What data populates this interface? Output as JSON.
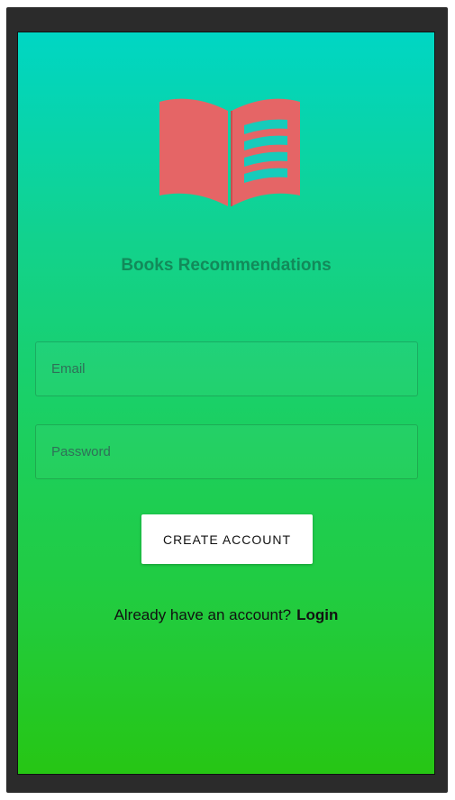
{
  "app": {
    "title": "Books Recommendations",
    "logo_icon": "open-book-icon",
    "logo_color": "#e56566"
  },
  "form": {
    "email_placeholder": "Email",
    "email_value": "",
    "password_placeholder": "Password",
    "password_value": "",
    "create_button_label": "CREATE ACCOUNT"
  },
  "footer": {
    "prompt": "Already have an account?",
    "login_label": "Login"
  },
  "colors": {
    "gradient_top": "#00d6c4",
    "gradient_bottom": "#26c614",
    "title_color": "#128a5a"
  }
}
